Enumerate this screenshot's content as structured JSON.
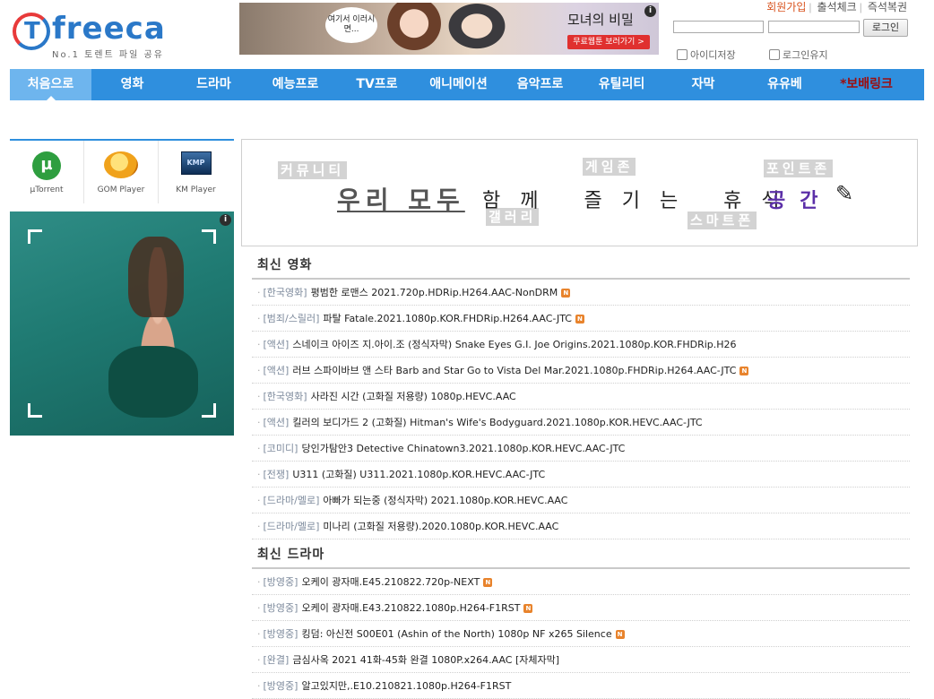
{
  "header": {
    "logo_word": "freeca",
    "logo_tagline": "No.1 토렌트 파일 공유",
    "banner": {
      "bubble_text": "여기서 이러시면...",
      "title": "모녀의 비밀",
      "cta": "무료웹툰 보러가기 >",
      "info": "i"
    },
    "top_links": {
      "join": "회원가입",
      "attendance": "출석체크",
      "lottery": "즉석복권"
    },
    "login": {
      "button": "로그인",
      "save_id": "아이디저장",
      "keep_login": "로그인유지"
    }
  },
  "nav": {
    "items": [
      "처음으로",
      "영화",
      "드라마",
      "예능프로",
      "TV프로",
      "애니메이션",
      "음악프로",
      "유틸리티",
      "자막",
      "유유베",
      "*보배링크"
    ]
  },
  "sidebar": {
    "apps": [
      {
        "label": "µTorrent",
        "icon": "utorrent-icon"
      },
      {
        "label": "GOM Player",
        "icon": "gom-player-icon"
      },
      {
        "label": "KM Player",
        "icon": "km-player-icon"
      }
    ],
    "kmp_badge": "KMP",
    "ad_info": "i"
  },
  "hero": {
    "ghost_community": "커뮤니티",
    "ghost_game": "게임존",
    "ghost_point": "포인트존",
    "ghost_gallery": "갤러리",
    "ghost_smart": "스마트폰",
    "main": "우리 모두",
    "mid": "함께 즐기는 휴식",
    "accent": "공간"
  },
  "movies": {
    "title": "최신 영화",
    "rows": [
      {
        "cat": "[한국영화]",
        "title": "평범한 로맨스 2021.720p.HDRip.H264.AAC-NonDRM",
        "new": true
      },
      {
        "cat": "[범죄/스릴러]",
        "title": "파탈 Fatale.2021.1080p.KOR.FHDRip.H264.AAC-JTC",
        "new": true
      },
      {
        "cat": "[액션]",
        "title": "스네이크 아이즈 지.아이.조 (정식자막) Snake Eyes G.I. Joe Origins.2021.1080p.KOR.FHDRip.H26",
        "new": false
      },
      {
        "cat": "[액션]",
        "title": "러브 스파이바브 앤 스타 Barb and Star Go to Vista Del Mar.2021.1080p.FHDRip.H264.AAC-JTC",
        "new": true
      },
      {
        "cat": "[한국영화]",
        "title": "사라진 시간 (고화질 저용량) 1080p.HEVC.AAC",
        "new": false
      },
      {
        "cat": "[액션]",
        "title": "킬러의 보디가드 2 (고화질) Hitman's Wife's Bodyguard.2021.1080p.KOR.HEVC.AAC-JTC",
        "new": false
      },
      {
        "cat": "[코미디]",
        "title": "당인가탐안3 Detective Chinatown3.2021.1080p.KOR.HEVC.AAC-JTC",
        "new": false
      },
      {
        "cat": "[전쟁]",
        "title": "U311 (고화질) U311.2021.1080p.KOR.HEVC.AAC-JTC",
        "new": false
      },
      {
        "cat": "[드라마/멜로]",
        "title": "아빠가 되는중 (정식자막) 2021.1080p.KOR.HEVC.AAC",
        "new": false
      },
      {
        "cat": "[드라마/멜로]",
        "title": "미나리 (고화질 저용량).2020.1080p.KOR.HEVC.AAC",
        "new": false
      }
    ]
  },
  "dramas": {
    "title": "최신 드라마",
    "rows": [
      {
        "cat": "[방영중]",
        "title": "오케이 광자매.E45.210822.720p-NEXT",
        "new": true
      },
      {
        "cat": "[방영중]",
        "title": "오케이 광자매.E43.210822.1080p.H264-F1RST",
        "new": true
      },
      {
        "cat": "[방영중]",
        "title": "킹덤: 아신전 S00E01 (Ashin of the North) 1080p NF x265 Silence",
        "new": true
      },
      {
        "cat": "[완결]",
        "title": "금심사옥 2021 41화-45화 완결 1080P.x264.AAC [자체자막]",
        "new": false
      },
      {
        "cat": "[방영중]",
        "title": "알고있지만,.E10.210821.1080p.H264-F1RST",
        "new": false
      }
    ]
  },
  "new_badge": "N",
  "colors": {
    "nav_bg": "#2f8fde",
    "nav_active": "#6eb5ee",
    "accent_join": "#d9531e",
    "special_link": "#9d0c0c",
    "hero_accent": "#5b2fa8"
  }
}
